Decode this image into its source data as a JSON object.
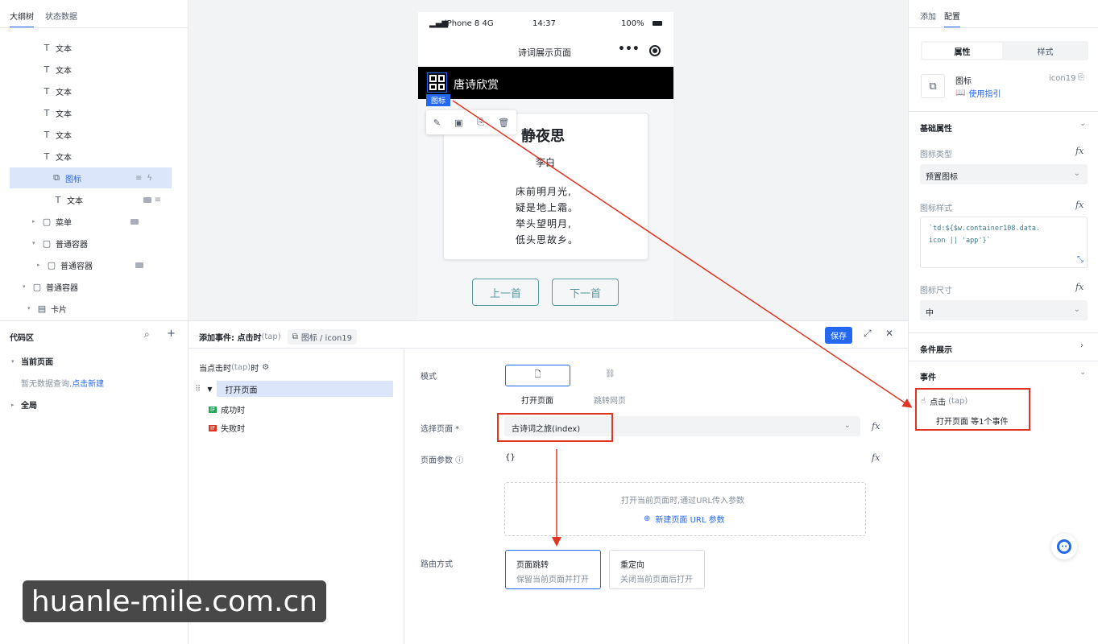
{
  "left_tabs": [
    "大纲树",
    "状态数据"
  ],
  "tree": [
    {
      "label": "文本",
      "icon": "text-icon"
    },
    {
      "label": "文本",
      "icon": "text-icon"
    },
    {
      "label": "文本",
      "icon": "text-icon"
    },
    {
      "label": "文本",
      "icon": "text-icon"
    },
    {
      "label": "文本",
      "icon": "text-icon"
    },
    {
      "label": "文本",
      "icon": "text-icon"
    },
    {
      "label": "图标",
      "icon": "shapes-icon",
      "selected": true
    },
    {
      "label": "文本",
      "icon": "text-icon"
    },
    {
      "label": "菜单",
      "icon": "box-icon"
    },
    {
      "label": "普通容器",
      "icon": "box-icon"
    },
    {
      "label": "普通容器",
      "icon": "box-icon"
    },
    {
      "label": "普通容器",
      "icon": "box-icon"
    },
    {
      "label": "卡片",
      "icon": "card-icon"
    }
  ],
  "code_area": {
    "title": "代码区",
    "current_page": "当前页面",
    "empty_hint": "暂无数据查询,",
    "create_link": "点击新建",
    "global": "全局"
  },
  "phone": {
    "signal": "iPhone 8  4G",
    "time": "14:37",
    "battery": "100%",
    "nav_title": "诗词展示页面",
    "header_title": "唐诗欣赏",
    "icon_tag": "图标",
    "poem_title": "静夜思",
    "poem_author": "李白",
    "poem_lines": [
      "床前明月光,",
      "疑是地上霜。",
      "举头望明月,",
      "低头思故乡。"
    ],
    "prev_btn": "上一首",
    "next_btn": "下一首"
  },
  "event_panel": {
    "title": "添加事件: 点击时",
    "title_tap": "(tap)",
    "breadcrumb": "图标 / icon19",
    "save": "保存",
    "trigger": "当点击时",
    "trigger_tap": "(tap)",
    "trigger_suffix": "时",
    "action": "打开页面",
    "success": "成功时",
    "fail": "失败时",
    "mode_label": "模式",
    "mode_open": "打开页面",
    "mode_jump": "跳转网页",
    "select_page_label": "选择页面",
    "select_page_value": "古诗词之旅(index)",
    "page_params_label": "页面参数",
    "page_params_value": "{}",
    "params_hint": "打开当前页面时,通过URL传入参数",
    "new_param": "新建页面 URL 参数",
    "route_label": "路由方式",
    "route_nav": "页面跳转",
    "route_nav_desc": "保留当前页面并打开",
    "route_redirect": "重定向",
    "route_redirect_desc": "关闭当前页面后打开"
  },
  "right_panel": {
    "tabs": [
      "添加",
      "配置"
    ],
    "seg": [
      "属性",
      "样式"
    ],
    "component_name": "图标",
    "component_id": "icon19",
    "guide": "使用指引",
    "basic_props": "基础属性",
    "icon_type_label": "图标类型",
    "icon_type_value": "预置图标",
    "icon_style_label": "图标样式",
    "icon_style_code_1": "`td:${$w.container108.data.",
    "icon_style_code_2": "icon || 'app'}`",
    "icon_size_label": "图标尺寸",
    "icon_size_value": "中",
    "cond_display": "条件展示",
    "events": "事件",
    "event_name": "点击",
    "event_tap": "(tap)",
    "event_desc": "打开页面 等1个事件"
  },
  "watermark": "huanle-mile.com.cn",
  "colors": {
    "accent": "#2468f2",
    "annotation": "#e03524",
    "phone_header": "#000000",
    "button_teal": "#5a9aa4"
  }
}
